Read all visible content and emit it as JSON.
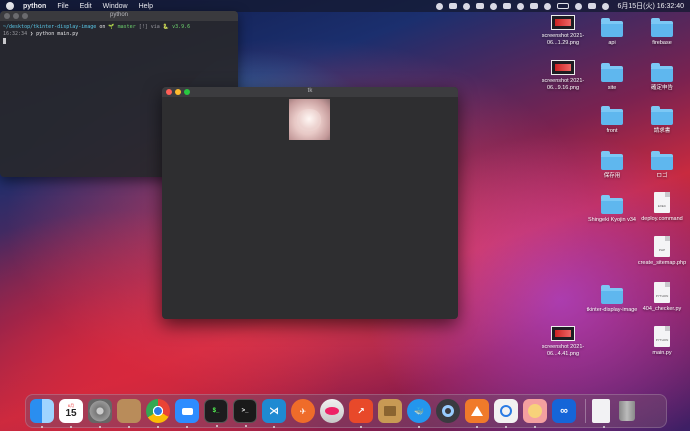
{
  "menubar": {
    "app": "python",
    "items": [
      "File",
      "Edit",
      "Window",
      "Help"
    ],
    "clock": "6月15日(火) 16:32:40"
  },
  "terminal": {
    "title": "python",
    "prompt_path": "~/desktop/tkinter-display-image",
    "prompt_on": "on",
    "prompt_branch": "master",
    "prompt_status": "[!] via",
    "prompt_version": "v3.9.6",
    "cmd_time": "16:32:34",
    "cmd_text": "python main.py"
  },
  "tk_window": {
    "title": "tk"
  },
  "desktop": {
    "icons": [
      {
        "label": "screenshot 2021-06...1.29.png",
        "type": "thumb"
      },
      {
        "label": "api",
        "type": "folder"
      },
      {
        "label": "firebase",
        "type": "folder"
      },
      {
        "label": "screenshot 2021-06...9.16.png",
        "type": "thumb"
      },
      {
        "label": "site",
        "type": "folder"
      },
      {
        "label": "確定申告",
        "type": "folder"
      },
      {
        "label": "front",
        "type": "folder"
      },
      {
        "label": "請求書",
        "type": "folder"
      },
      {
        "label": "保存用",
        "type": "folder"
      },
      {
        "label": "ロゴ",
        "type": "folder"
      },
      {
        "label": "Shingeki Kyojin v34",
        "type": "folder"
      },
      {
        "label": "deploy.command",
        "type": "doc",
        "tag": "EXEC"
      },
      {
        "label": "create_sitemap.php",
        "type": "doc",
        "tag": "PHP"
      },
      {
        "label": "tkinter-display-image",
        "type": "folder"
      },
      {
        "label": "404_checker.py",
        "type": "doc",
        "tag": "PYTHON"
      },
      {
        "label": "screenshot 2021-06...4.41.png",
        "type": "thumb"
      },
      {
        "label": "main.py",
        "type": "doc",
        "tag": "PYTHON"
      }
    ]
  },
  "dock": {
    "calendar_month": "6月",
    "calendar_day": "15",
    "apps": [
      {
        "name": "finder-icon",
        "color": "#2a8ef0"
      },
      {
        "name": "calendar-icon",
        "color": "#ffffff"
      },
      {
        "name": "system-preferences-icon",
        "color": "#8a8a90"
      },
      {
        "name": "contacts-icon",
        "color": "#b98c5a"
      },
      {
        "name": "chrome-icon",
        "color": "#eeeeee"
      },
      {
        "name": "zoom-icon",
        "color": "#2d8cff"
      },
      {
        "name": "activity-monitor-icon",
        "color": "#222"
      },
      {
        "name": "terminal-icon",
        "color": "#1a1a1a"
      },
      {
        "name": "vscode-icon",
        "color": "#1f8ad2"
      },
      {
        "name": "postman-icon",
        "color": "#ef6c2a"
      },
      {
        "name": "sequel-icon",
        "color": "#d9d9d9"
      },
      {
        "name": "stocks-icon",
        "color": "#e8492a"
      },
      {
        "name": "archive-icon",
        "color": "#c89a54"
      },
      {
        "name": "docker-icon",
        "color": "#2496ed"
      },
      {
        "name": "quicktime-icon",
        "color": "#3a3a40"
      },
      {
        "name": "sourcetree-icon",
        "color": "#f07a2a"
      },
      {
        "name": "lookup-icon",
        "color": "#f2f2f2"
      },
      {
        "name": "python-launcher-icon",
        "color": "#f4a0a0"
      },
      {
        "name": "infinity-icon",
        "color": "#1565d8"
      }
    ]
  }
}
